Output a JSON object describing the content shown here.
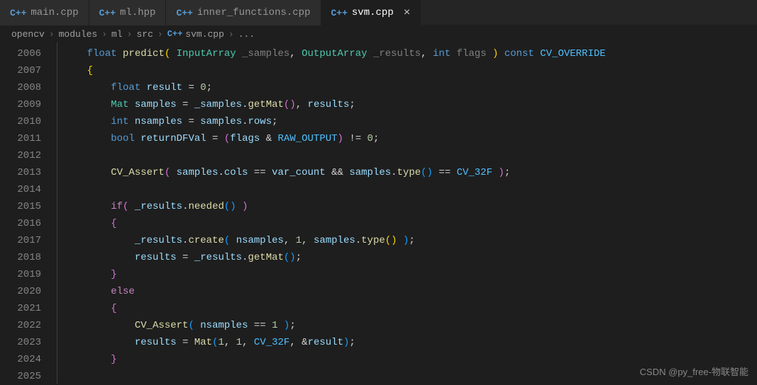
{
  "tabs": [
    {
      "icon": "C++",
      "label": "main.cpp",
      "active": false
    },
    {
      "icon": "C++",
      "label": "ml.hpp",
      "active": false
    },
    {
      "icon": "C++",
      "label": "inner_functions.cpp",
      "active": false
    },
    {
      "icon": "C++",
      "label": "svm.cpp",
      "active": true
    }
  ],
  "breadcrumb": {
    "parts": [
      "opencv",
      "modules",
      "ml",
      "src"
    ],
    "file_icon": "C++",
    "file": "svm.cpp",
    "tail": "..."
  },
  "line_start": 2006,
  "line_count": 20,
  "watermark": "CSDN @py_free-物联智能",
  "code": {
    "l0": {
      "indent": 2,
      "tokens": [
        "float ",
        "predict",
        "( ",
        "InputArray",
        " _samples",
        ", ",
        "OutputArray",
        " _results",
        ", ",
        "int",
        " flags ",
        ")",
        " ",
        "const",
        " CV_OVERRIDE"
      ]
    },
    "l1": {
      "t": "    {"
    },
    "l2": {
      "t": "        float result = 0;"
    },
    "l3": {
      "t": "        Mat samples = _samples.getMat(), results;"
    },
    "l4": {
      "t": "        int nsamples = samples.rows;"
    },
    "l5": {
      "t": "        bool returnDFVal = (flags & RAW_OUTPUT) != 0;"
    },
    "l6": {
      "t": ""
    },
    "l7": {
      "t": "        CV_Assert( samples.cols == var_count && samples.type() == CV_32F );"
    },
    "l8": {
      "t": ""
    },
    "l9": {
      "t": "        if( _results.needed() )"
    },
    "l10": {
      "t": "        {"
    },
    "l11": {
      "t": "            _results.create( nsamples, 1, samples.type() );"
    },
    "l12": {
      "t": "            results = _results.getMat();"
    },
    "l13": {
      "t": "        }"
    },
    "l14": {
      "t": "        else"
    },
    "l15": {
      "t": "        {"
    },
    "l16": {
      "t": "            CV_Assert( nsamples == 1 );"
    },
    "l17": {
      "t": "            results = Mat(1, 1, CV_32F, &result);"
    },
    "l18": {
      "t": "        }"
    },
    "l19": {
      "t": ""
    }
  }
}
